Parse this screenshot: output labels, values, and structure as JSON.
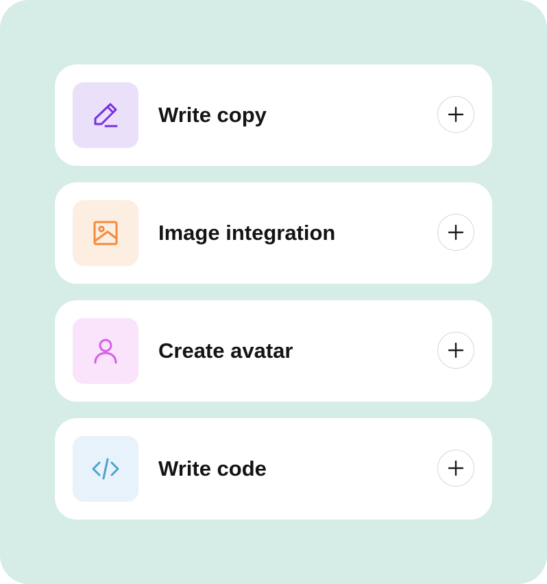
{
  "colors": {
    "background": "#d5ece7",
    "card": "#ffffff",
    "text": "#141414"
  },
  "actions": [
    {
      "label": "Write copy",
      "icon": "pencil-icon",
      "icon_color": "#7a2ee0",
      "tile_color": "#ebe0fa"
    },
    {
      "label": "Image integration",
      "icon": "image-icon",
      "icon_color": "#f48a3c",
      "tile_color": "#fdeee2"
    },
    {
      "label": "Create avatar",
      "icon": "user-icon",
      "icon_color": "#d45ee8",
      "tile_color": "#f9e4fc"
    },
    {
      "label": "Write code",
      "icon": "code-icon",
      "icon_color": "#4aa3d0",
      "tile_color": "#e8f2fa"
    }
  ]
}
